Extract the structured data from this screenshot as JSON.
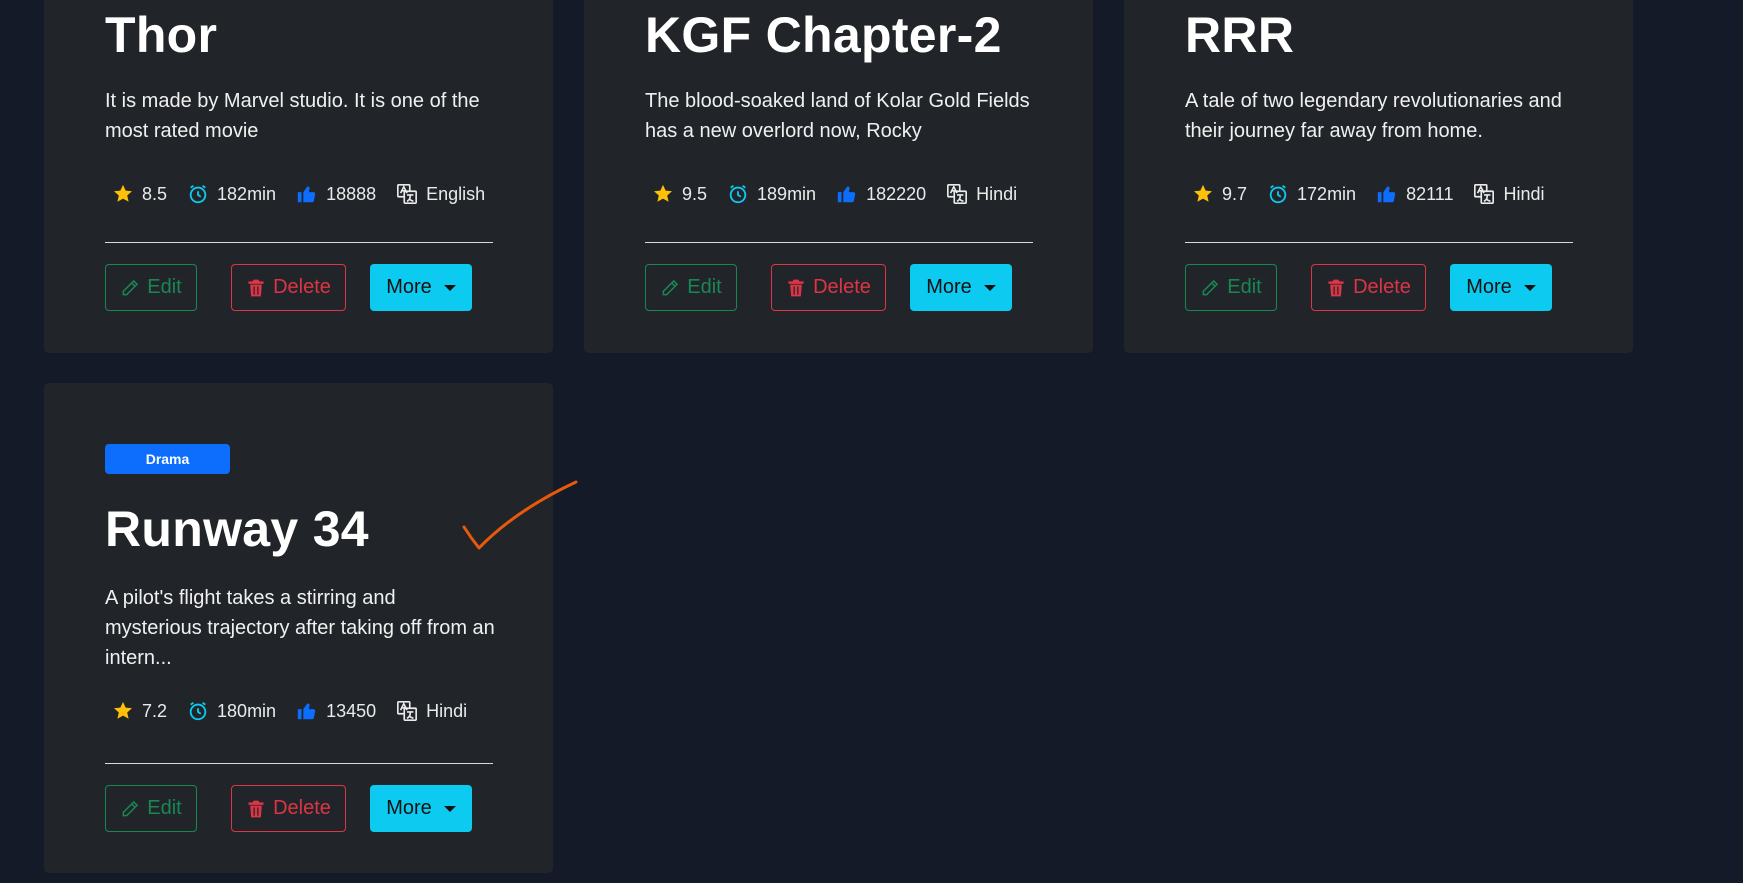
{
  "labels": {
    "edit": "Edit",
    "delete": "Delete",
    "more": "More"
  },
  "colors": {
    "background": "#141a27",
    "card": "#212529",
    "edit": "#198754",
    "delete": "#dc3545",
    "more": "#0dcaf0",
    "badge": "#0d6efd",
    "star": "#ffc107",
    "clock": "#0dcaf0",
    "thumb": "#0d6efd",
    "checkmark": "#e8590c"
  },
  "icons": [
    "star-icon",
    "clock-icon",
    "thumbs-up-icon",
    "translate-icon",
    "pencil-icon",
    "trash-icon",
    "caret-down-icon",
    "checkmark-annotation"
  ],
  "movies": [
    {
      "title": "Thor",
      "description": "It is made by Marvel studio. It is one of the most rated movie",
      "rating": "8.5",
      "duration": "182min",
      "likes": "18888",
      "language": "English"
    },
    {
      "title": "KGF Chapter-2",
      "description": "The blood-soaked land of Kolar Gold Fields has a new overlord now, Rocky",
      "rating": "9.5",
      "duration": "189min",
      "likes": "182220",
      "language": "Hindi"
    },
    {
      "title": "RRR",
      "description": "A tale of two legendary revolutionaries and their journey far away from home.",
      "rating": "9.7",
      "duration": "172min",
      "likes": "82111",
      "language": "Hindi"
    },
    {
      "genre": "Drama",
      "title": "Runway 34",
      "description": "A pilot's flight takes a stirring and mysterious trajectory after taking off from an intern...",
      "rating": "7.2",
      "duration": "180min",
      "likes": "13450",
      "language": "Hindi"
    }
  ]
}
